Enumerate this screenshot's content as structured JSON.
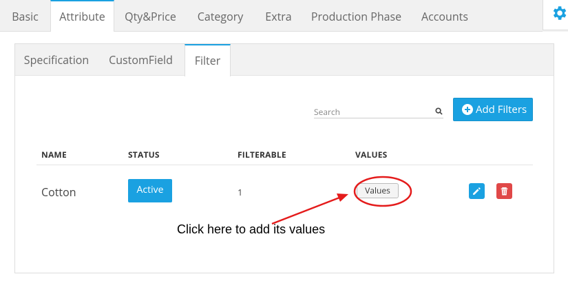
{
  "top_tabs": [
    "Basic",
    "Attribute",
    "Qty&Price",
    "Category",
    "Extra",
    "Production Phase",
    "Accounts"
  ],
  "active_top_tab": "Attribute",
  "sub_tabs": [
    "Specification",
    "CustomField",
    "Filter"
  ],
  "active_sub_tab": "Filter",
  "search": {
    "placeholder": "Search"
  },
  "add_button": "Add Filters",
  "table": {
    "headers": [
      "NAME",
      "STATUS",
      "FILTERABLE",
      "VALUES"
    ],
    "rows": [
      {
        "name": "Cotton",
        "status": "Active",
        "filterable": "1",
        "values_button": "Values"
      }
    ]
  },
  "annotation": "Click here to add its values",
  "colors": {
    "accent": "#1aa1e1",
    "danger": "#e04848",
    "annotation": "#e41b1b"
  },
  "icons": {
    "settings": "gear-icon",
    "search": "search-icon",
    "add": "plus-circle-icon",
    "edit": "pencil-icon",
    "delete": "trash-icon"
  }
}
